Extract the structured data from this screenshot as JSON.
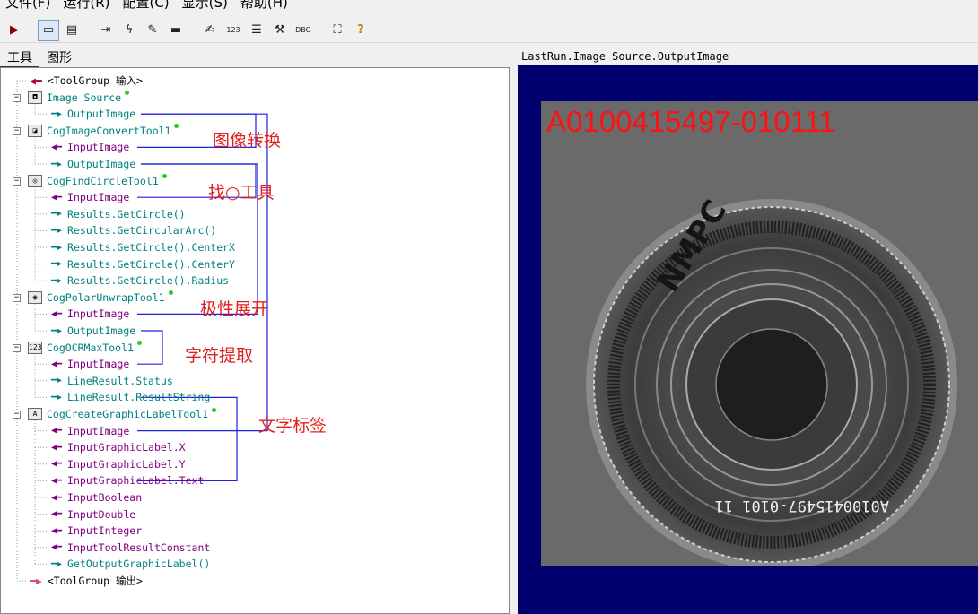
{
  "menu": [
    "文件(F)",
    "运行(R)",
    "配置(C)",
    "显示(S)",
    "帮助(H)"
  ],
  "toolbar": [
    {
      "icon": "run-icon",
      "glyph": "▶"
    },
    {
      "icon": "display-icon",
      "glyph": "▭"
    },
    {
      "icon": "image-source-icon",
      "glyph": "▤"
    },
    {
      "icon": "import-icon",
      "glyph": "⇥"
    },
    {
      "icon": "flash-icon",
      "glyph": "ϟ"
    },
    {
      "icon": "brush-icon",
      "glyph": "✎"
    },
    {
      "icon": "link-icon",
      "glyph": "▬"
    },
    {
      "icon": "edit-icon",
      "glyph": "✍"
    },
    {
      "icon": "number-icon",
      "glyph": "123"
    },
    {
      "icon": "list-icon",
      "glyph": "☰"
    },
    {
      "icon": "tools-icon",
      "glyph": "⚒"
    },
    {
      "icon": "debug-icon",
      "glyph": "DBG"
    },
    {
      "icon": "fit-icon",
      "glyph": "⛶"
    },
    {
      "icon": "help-icon",
      "glyph": "?"
    }
  ],
  "tabs": [
    {
      "label": "工具"
    },
    {
      "label": "图形"
    }
  ],
  "tree": [
    {
      "text": "<ToolGroup 输入>",
      "kind": "term"
    },
    {
      "text": "Image Source",
      "kind": "tool",
      "icon": "camera-icon",
      "glyph": "◘"
    },
    {
      "text": "OutputImage",
      "kind": "out"
    },
    {
      "text": "CogImageConvertTool1",
      "kind": "tool",
      "icon": "convert-icon",
      "glyph": "◪"
    },
    {
      "text": "InputImage",
      "kind": "in"
    },
    {
      "text": "OutputImage",
      "kind": "out"
    },
    {
      "text": "CogFindCircleTool1",
      "kind": "tool",
      "icon": "find-circle-icon",
      "glyph": "◎"
    },
    {
      "text": "InputImage",
      "kind": "in"
    },
    {
      "text": "Results.GetCircle()",
      "kind": "out"
    },
    {
      "text": "Results.GetCircularArc()",
      "kind": "out"
    },
    {
      "text": "Results.GetCircle().CenterX",
      "kind": "out"
    },
    {
      "text": "Results.GetCircle().CenterY",
      "kind": "out"
    },
    {
      "text": "Results.GetCircle().Radius",
      "kind": "out"
    },
    {
      "text": "CogPolarUnwrapTool1",
      "kind": "tool",
      "icon": "polar-unwrap-icon",
      "glyph": "◉"
    },
    {
      "text": "InputImage",
      "kind": "in"
    },
    {
      "text": "OutputImage",
      "kind": "out"
    },
    {
      "text": "CogOCRMaxTool1",
      "kind": "tool",
      "icon": "ocr-icon",
      "glyph": "123"
    },
    {
      "text": "InputImage",
      "kind": "in"
    },
    {
      "text": "LineResult.Status",
      "kind": "out"
    },
    {
      "text": "LineResult.ResultString",
      "kind": "out"
    },
    {
      "text": "CogCreateGraphicLabelTool1",
      "kind": "tool",
      "icon": "graphic-label-icon",
      "glyph": "A"
    },
    {
      "text": "InputImage",
      "kind": "in"
    },
    {
      "text": "InputGraphicLabel.X",
      "kind": "in"
    },
    {
      "text": "InputGraphicLabel.Y",
      "kind": "in"
    },
    {
      "text": "InputGraphicLabel.Text",
      "kind": "in"
    },
    {
      "text": "InputBoolean",
      "kind": "in"
    },
    {
      "text": "InputDouble",
      "kind": "in"
    },
    {
      "text": "InputInteger",
      "kind": "in"
    },
    {
      "text": "InputToolResultConstant",
      "kind": "in"
    },
    {
      "text": "GetOutputGraphicLabel()",
      "kind": "out"
    },
    {
      "text": "<ToolGroup 输出>",
      "kind": "term"
    }
  ],
  "annotations": [
    "图像转换",
    "找○工具",
    "极性展开",
    "字符提取",
    "文字标签"
  ],
  "display": {
    "title": "LastRun.Image Source.OutputImage",
    "result_text": "A0100415497-010111",
    "disc_text": "A0100415497-0101  11"
  },
  "colors": {
    "tool": "#008080",
    "input": "#800080",
    "output": "#008080",
    "link": "#2020e0",
    "annotation": "#e02020",
    "display_bg": "#00006e"
  }
}
